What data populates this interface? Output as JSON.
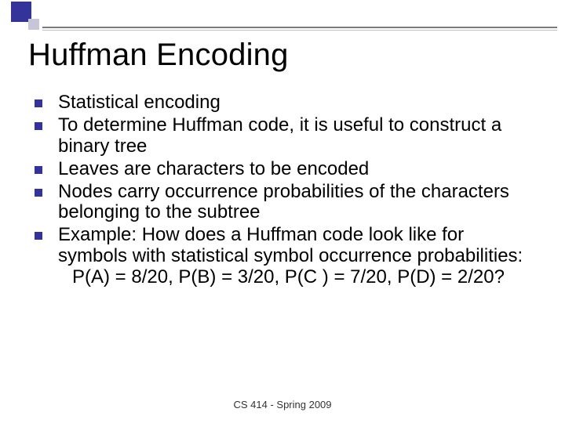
{
  "title": "Huffman Encoding",
  "bullets_group1": [
    "Statistical encoding",
    "To determine Huffman code, it is useful to construct a binary tree",
    "Leaves are characters to be encoded",
    "Nodes carry occurrence probabilities of the characters belonging to the subtree"
  ],
  "bullets_group2": {
    "intro": "Example: How does a Huffman code look like for symbols with statistical symbol occurrence probabilities:",
    "probabilities_line": "P(A) = 8/20, P(B) = 3/20, P(C ) = 7/20, P(D) = 2/20?"
  },
  "footer": "CS 414 - Spring 2009"
}
